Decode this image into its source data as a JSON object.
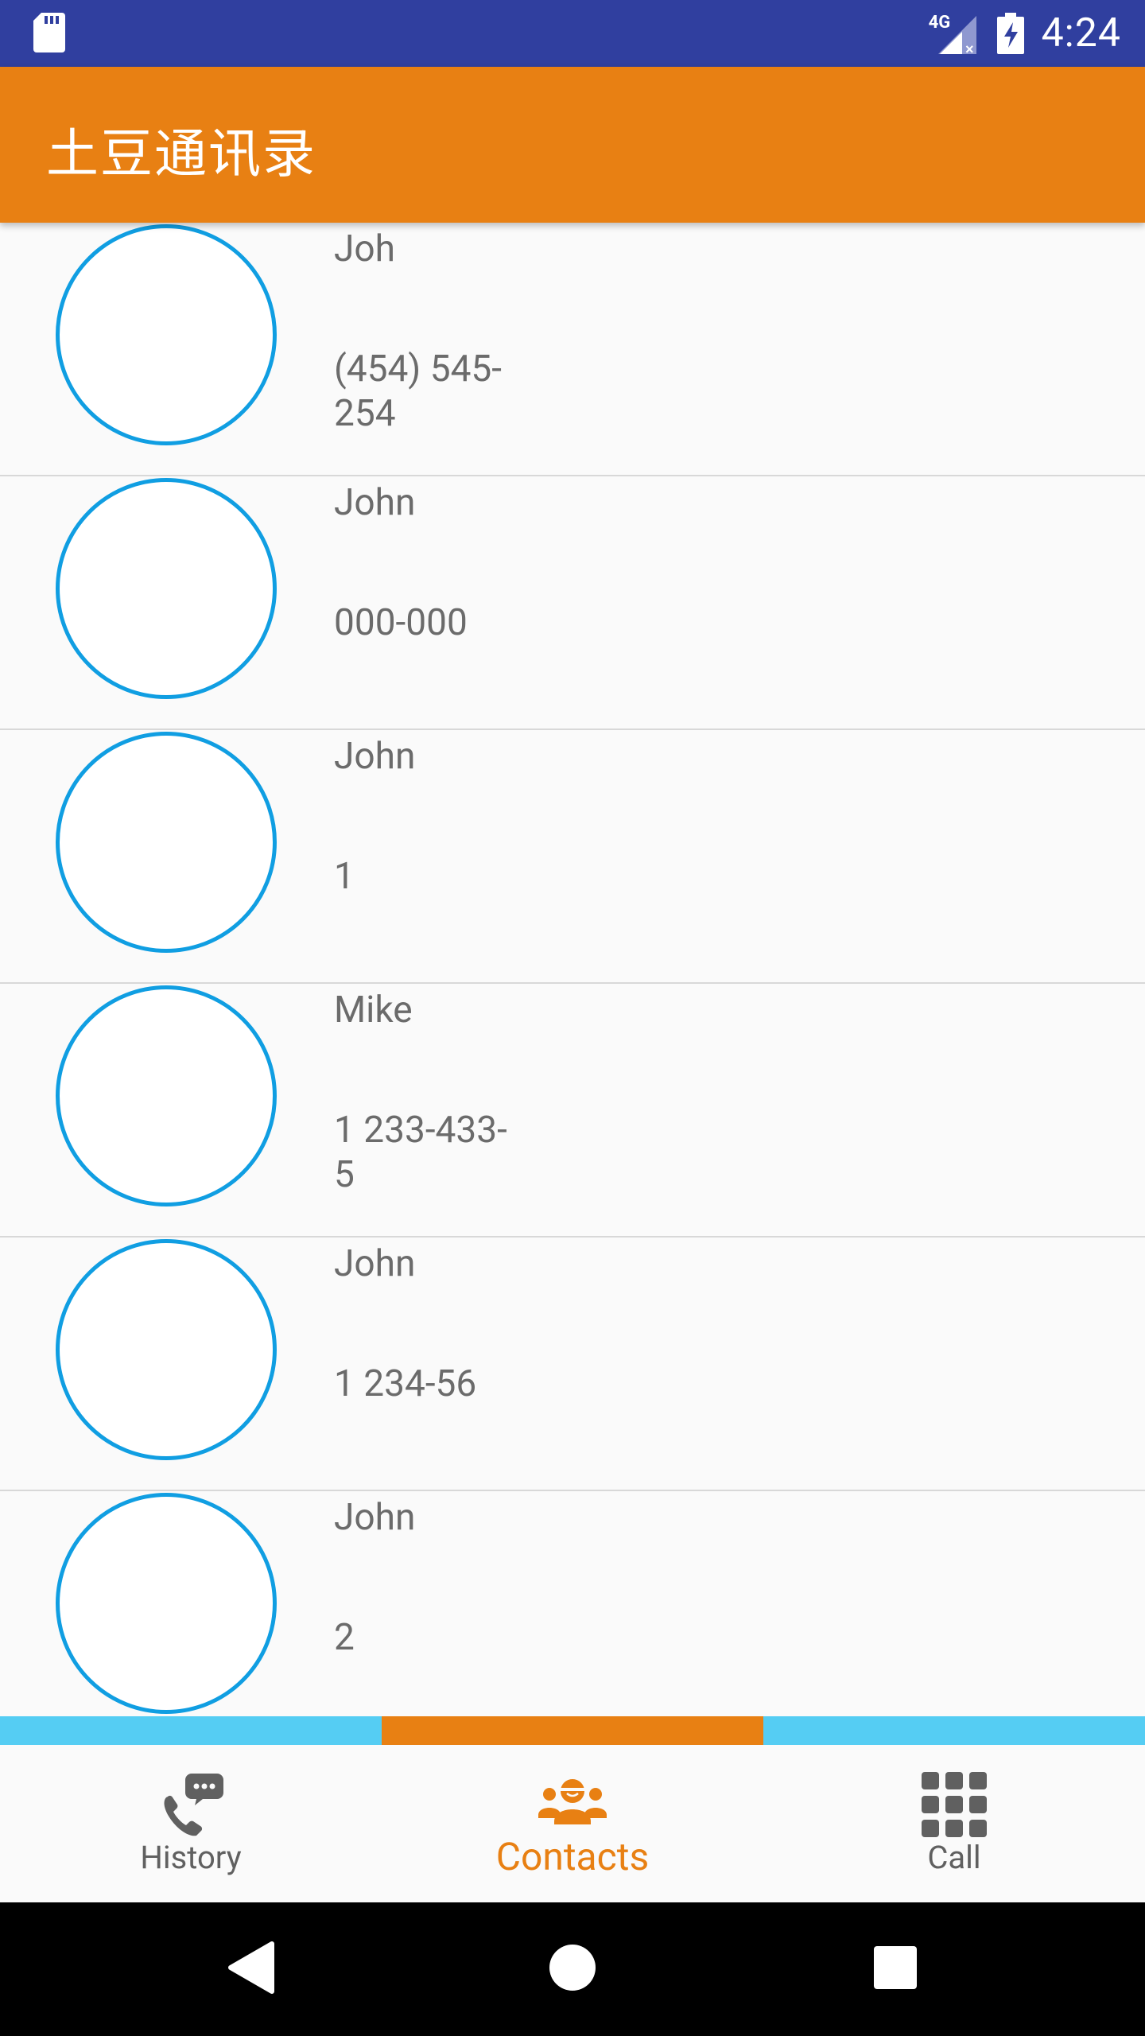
{
  "status_bar": {
    "time": "4:24",
    "network_label": "4G",
    "icons": [
      "sd-card-icon",
      "signal-4g-icon",
      "battery-charging-icon"
    ]
  },
  "app_bar": {
    "title": "土豆通讯录"
  },
  "contacts": [
    {
      "name": "Joh",
      "number": "(454) 545-254"
    },
    {
      "name": "John",
      "number": "000-000"
    },
    {
      "name": "John",
      "number": "1"
    },
    {
      "name": "Mike",
      "number": "1 233-433-5"
    },
    {
      "name": "John",
      "number": "1 234-56"
    },
    {
      "name": "John",
      "number": "2"
    }
  ],
  "bottom_nav": {
    "tabs": [
      {
        "label": "History",
        "icon": "phone-chat-icon",
        "active": false
      },
      {
        "label": "Contacts",
        "icon": "contacts-group-icon",
        "active": true
      },
      {
        "label": "Call",
        "icon": "dialpad-icon",
        "active": false
      }
    ]
  },
  "colors": {
    "status_bar": "#303f9f",
    "app_bar": "#e88013",
    "avatar_ring": "#109ee2",
    "tab_indicator_inactive": "#55cdf3",
    "tab_indicator_active": "#e88013",
    "nav_inactive": "#606060"
  },
  "system_nav": {
    "icons": [
      "back-icon",
      "home-icon",
      "recents-icon"
    ]
  }
}
